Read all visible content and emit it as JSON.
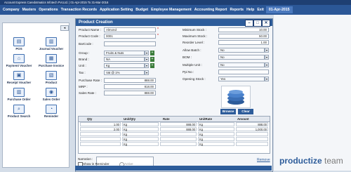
{
  "titlebar": {
    "text": "Account Express Caredotmatics Infotech Pvt.Ltd. | 01-Apr-2015 To 31-Mar-2016"
  },
  "menu": {
    "items": [
      "Company",
      "Masters",
      "Operations",
      "Transaction Records",
      "Application Setting",
      "Budget",
      "Employee Management",
      "Accounting Report",
      "Reports",
      "Help",
      "Exit"
    ],
    "date": "01-Apr-2015"
  },
  "left_panel": {
    "collapse": "◂",
    "tiles": [
      {
        "label": "POS",
        "icon": "pos-icon",
        "glyph": "▤"
      },
      {
        "label": "Journal Voucher",
        "icon": "journal-icon",
        "glyph": "▥"
      },
      {
        "label": "Payment Voucher",
        "icon": "payment-icon",
        "glyph": "⌂"
      },
      {
        "label": "Purchase Invoice",
        "icon": "invoice-icon",
        "glyph": "▦"
      },
      {
        "label": "Receipt Voucher",
        "icon": "receipt-icon",
        "glyph": "▣"
      },
      {
        "label": "Product",
        "icon": "product-icon",
        "glyph": "▧"
      },
      {
        "label": "Purchase Order",
        "icon": "purchase-order-icon",
        "glyph": "▥"
      },
      {
        "label": "Sales Order",
        "icon": "sales-order-icon",
        "glyph": "◉"
      },
      {
        "label": "Product Search",
        "icon": "product-search-icon",
        "glyph": "⌕"
      },
      {
        "label": "Reminder",
        "icon": "reminder-icon",
        "glyph": "◔"
      }
    ]
  },
  "window": {
    "title": "Product Creation",
    "btn_min": "–",
    "btn_max": "□",
    "btn_close": "✕"
  },
  "form": {
    "product_name_label": "Product Name :",
    "product_name": "Almond",
    "product_code_label": "Product Code :",
    "product_code": "0001",
    "barcode_label": "BarCode :",
    "barcode": "",
    "group_label": "Group :",
    "group": "Fruits & Nuts",
    "brand_label": "Brand :",
    "brand": "NA",
    "unit_label": "Unit :",
    "unit": "Kg",
    "tax_label": "Tax :",
    "tax": "Vat @ 1%",
    "purchase_rate_label": "Purchase Rate :",
    "purchase_rate": "888.00",
    "mrp_label": "MRP :",
    "mrp": "818.00",
    "sales_rate_label": "Sales Rate :",
    "sales_rate": "888.00",
    "min_stock_label": "Minimum Stock :",
    "min_stock": "10.00",
    "max_stock_label": "Maximum Stock :",
    "max_stock": "50.00",
    "reorder_label": "Reorder Level :",
    "reorder": "1.00",
    "allow_batch_label": "Allow Batch :",
    "allow_batch": "No",
    "bom_label": "BOM :",
    "bom": "No",
    "multiple_unit_label": "Multiple Unit :",
    "multiple_unit": "No",
    "ppi_label": "Ppi No :",
    "ppi": "",
    "opening_stock_label": "Opening Stock :",
    "opening_stock": "Yes"
  },
  "image_buttons": {
    "browse": "Browse",
    "clear": "Clear"
  },
  "grid": {
    "headers": [
      "Qty",
      "Unit/Qty",
      "Rate",
      "UnitRate",
      "Amount"
    ],
    "rows": [
      [
        "1.00",
        "Kg",
        "888.00",
        "Kg",
        "888.00"
      ],
      [
        "2.00",
        "Kg",
        "888.00",
        "Kg",
        "1,000.00"
      ],
      [
        "",
        "Kg",
        "",
        "Kg",
        ""
      ],
      [
        "",
        "Kg",
        "",
        "Kg",
        ""
      ],
      [
        "",
        "Kg",
        "",
        "Kg",
        ""
      ]
    ]
  },
  "narration_label": "Narration :",
  "remove": "Remove",
  "reminder_label": "Show in Reminder",
  "active_label": "Active",
  "brand_text_1": "productize",
  "brand_text_2": " team"
}
